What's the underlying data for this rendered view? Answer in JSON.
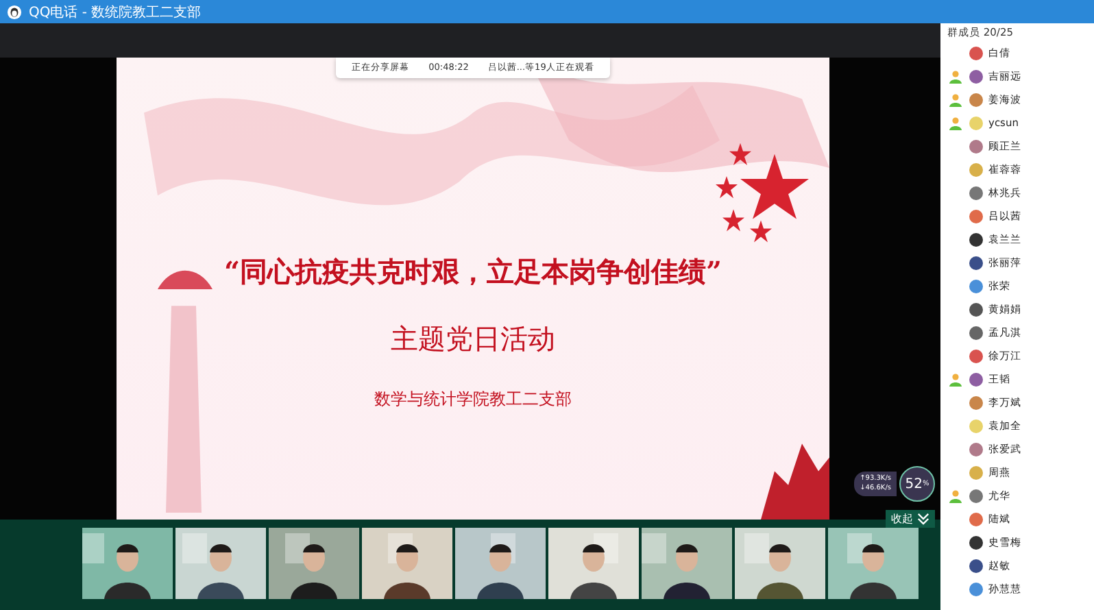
{
  "window": {
    "title": "QQ电话 - 数统院教工二支部"
  },
  "share_bar": {
    "status": "正在分享屏幕",
    "timer": "00:48:22",
    "viewers": "吕以茜...等19人正在观看"
  },
  "slide": {
    "title": "“同心抗疫共克时艰，立足本岗争创佳绩”",
    "subtitle": "主题党日活动",
    "organizer": "数学与统计学院教工二支部"
  },
  "network": {
    "upload": "↑93.3K/s",
    "download": "↓46.6K/s",
    "percent": "52",
    "unit": "%"
  },
  "collapse_button": {
    "label": "收起"
  },
  "members": {
    "title": "群成员 20/25",
    "items": [
      {
        "name": "白倩",
        "speaking": false
      },
      {
        "name": "吉丽远",
        "speaking": true
      },
      {
        "name": "姜海波",
        "speaking": true
      },
      {
        "name": "ycsun",
        "speaking": true
      },
      {
        "name": "顾正兰",
        "speaking": false
      },
      {
        "name": "崔蓉蓉",
        "speaking": false
      },
      {
        "name": "林兆兵",
        "speaking": false
      },
      {
        "name": "吕以茜",
        "speaking": false
      },
      {
        "name": "袁兰兰",
        "speaking": false
      },
      {
        "name": "张丽萍",
        "speaking": false
      },
      {
        "name": "张荣",
        "speaking": false
      },
      {
        "name": "黄娟娟",
        "speaking": false
      },
      {
        "name": "孟凡淇",
        "speaking": false
      },
      {
        "name": "徐万江",
        "speaking": false
      },
      {
        "name": "王韬",
        "speaking": true
      },
      {
        "name": "李万斌",
        "speaking": false
      },
      {
        "name": "袁加全",
        "speaking": false
      },
      {
        "name": "张爱武",
        "speaking": false
      },
      {
        "name": "周燕",
        "speaking": false
      },
      {
        "name": "尤华",
        "speaking": true
      },
      {
        "name": "陆斌",
        "speaking": false
      },
      {
        "name": "史雪梅",
        "speaking": false
      },
      {
        "name": "赵敏",
        "speaking": false
      },
      {
        "name": "孙慧慧",
        "speaking": false
      }
    ]
  }
}
